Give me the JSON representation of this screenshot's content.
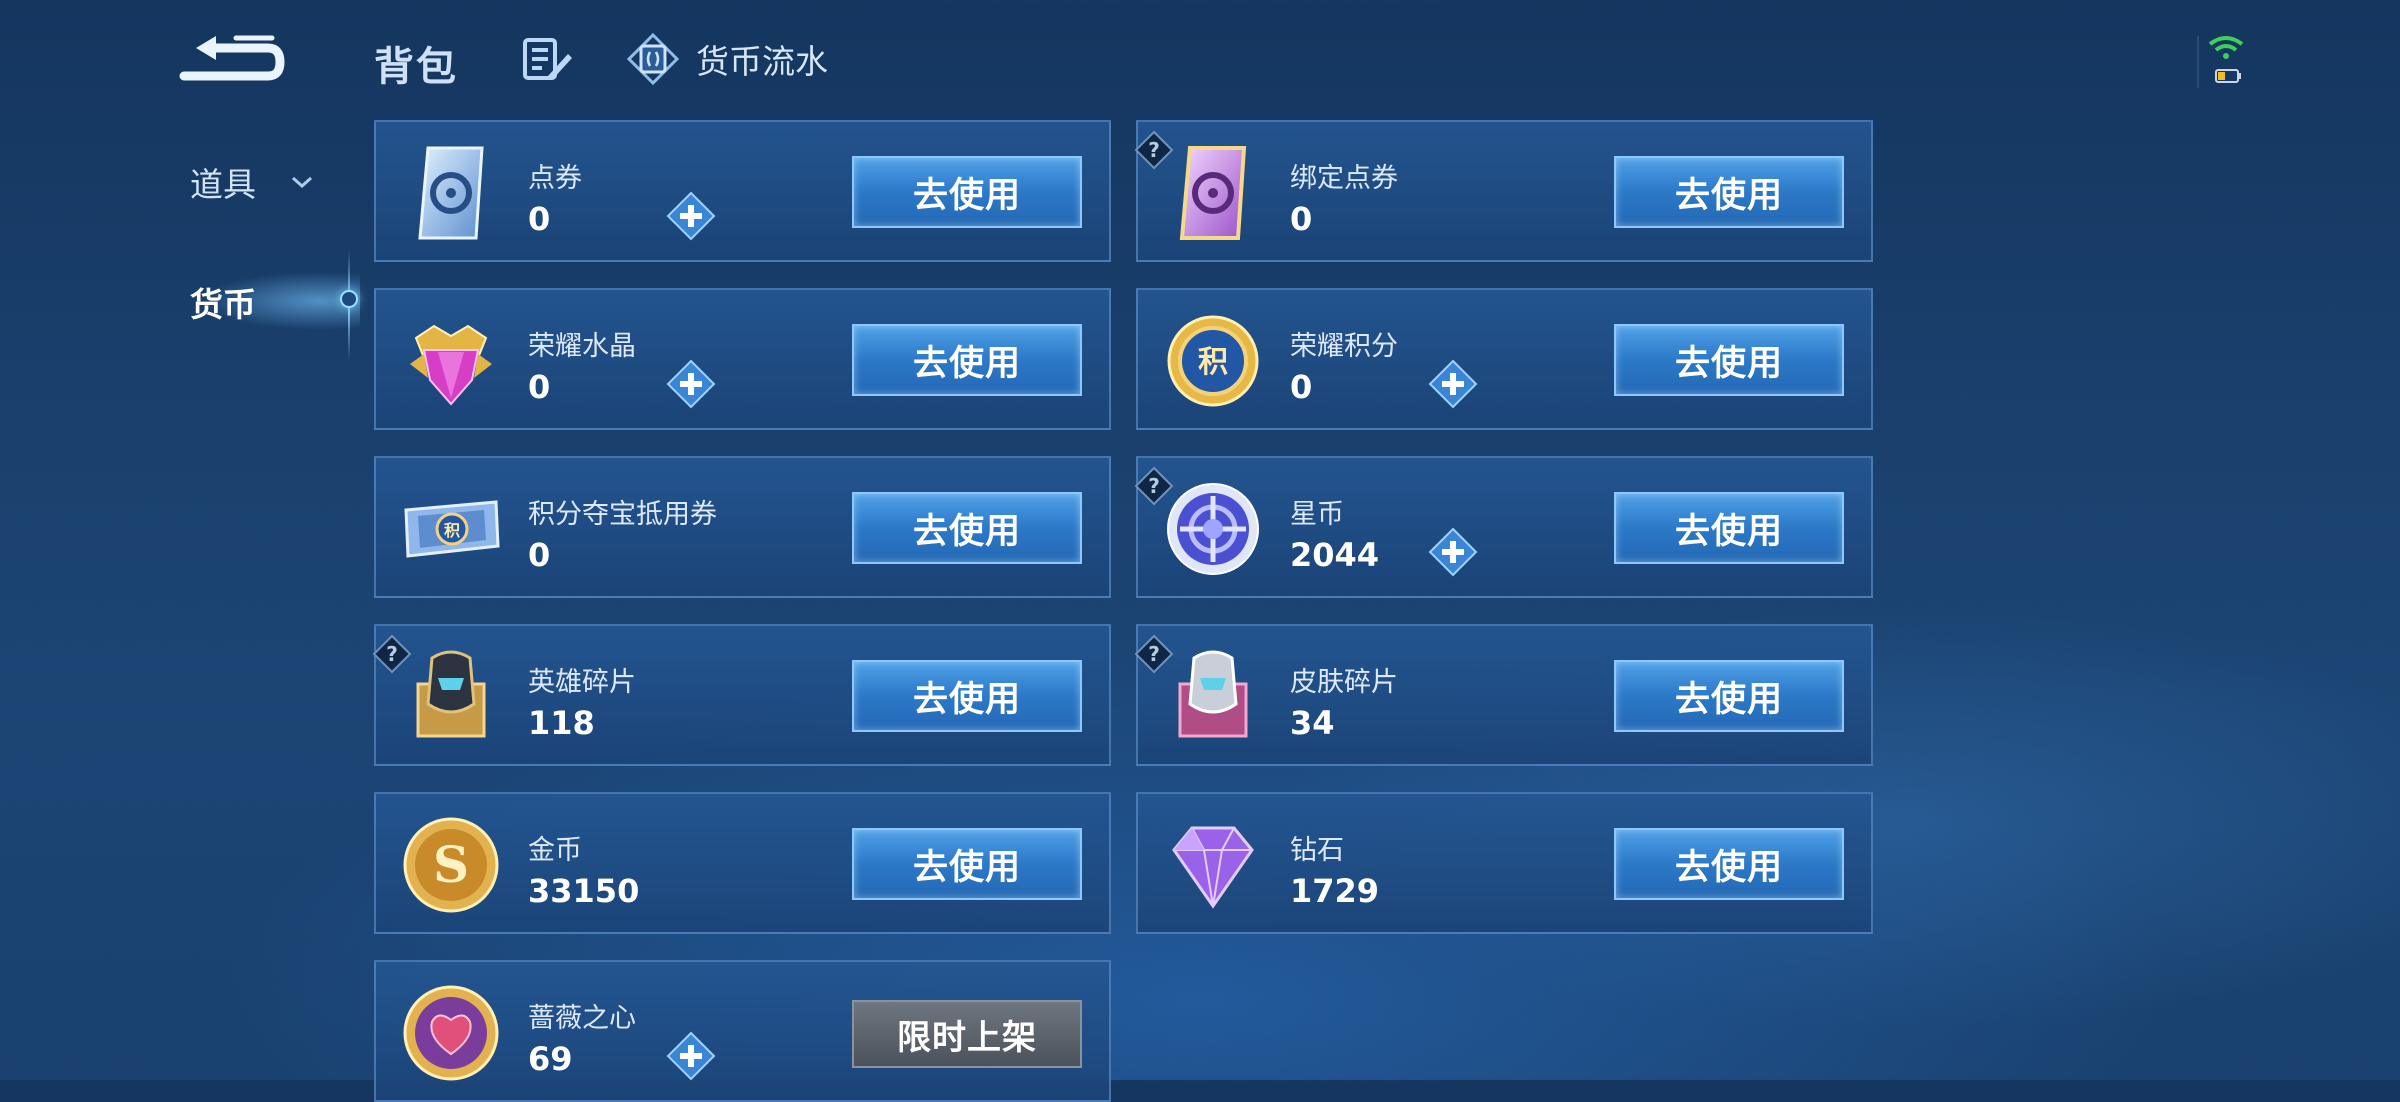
{
  "header": {
    "title": "背包",
    "flow_label": "货币流水"
  },
  "sidebar": {
    "items": [
      {
        "label": "道具"
      },
      {
        "label": "货币"
      }
    ]
  },
  "currencies": [
    {
      "name": "点券",
      "count": "0",
      "button": "去使用"
    },
    {
      "name": "绑定点券",
      "count": "0",
      "button": "去使用"
    },
    {
      "name": "荣耀水晶",
      "count": "0",
      "button": "去使用"
    },
    {
      "name": "荣耀积分",
      "count": "0",
      "button": "去使用"
    },
    {
      "name": "积分夺宝抵用券",
      "count": "0",
      "button": "去使用"
    },
    {
      "name": "星币",
      "count": "2044",
      "button": "去使用"
    },
    {
      "name": "英雄碎片",
      "count": "118",
      "button": "去使用"
    },
    {
      "name": "皮肤碎片",
      "count": "34",
      "button": "去使用"
    },
    {
      "name": "金币",
      "count": "33150",
      "button": "去使用"
    },
    {
      "name": "钻石",
      "count": "1729",
      "button": "去使用"
    },
    {
      "name": "蔷薇之心",
      "count": "69",
      "button": "限时上架"
    }
  ],
  "colors": {
    "button_blue": "#2c79c8",
    "button_disabled": "#4b525b",
    "background": "#1a3f6c"
  }
}
